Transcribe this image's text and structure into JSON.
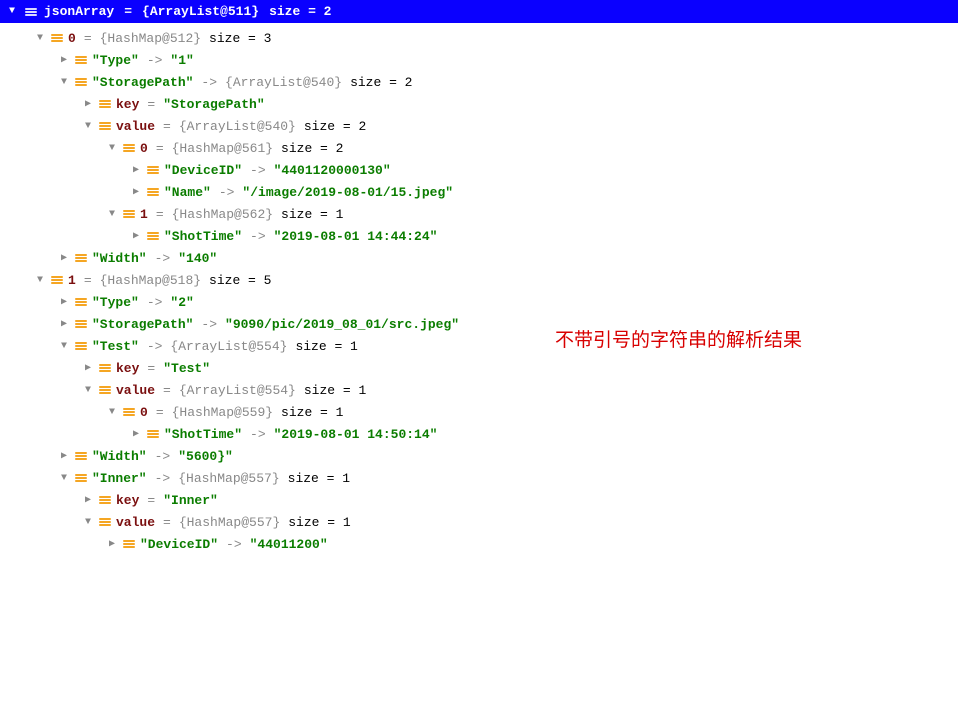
{
  "root": {
    "name": "jsonArray",
    "obj": "{ArrayList@511}",
    "size_label": "size = 2"
  },
  "annotation": "不带引号的字符串的解析结果",
  "r": {
    "i0": "0",
    "hm512": "{HashMap@512}",
    "sz3": "size = 3",
    "type_k": "\"Type\"",
    "type_v1": "\"1\"",
    "sp_k": "\"StoragePath\"",
    "al540": "{ArrayList@540}",
    "sz2": "size = 2",
    "key_label": "key",
    "sp_str": "\"StoragePath\"",
    "value_label": "value",
    "hm561": "{HashMap@561}",
    "devid_k": "\"DeviceID\"",
    "devid_v": "\"4401120000130\"",
    "name_k": "\"Name\"",
    "name_v": "\"/image/2019-08-01/15.jpeg\"",
    "i1": "1",
    "hm562": "{HashMap@562}",
    "sz1": "size = 1",
    "shot_k": "\"ShotTime\"",
    "shot_v1": "\"2019-08-01 14:44:24\"",
    "width_k": "\"Width\"",
    "width_v1": "\"140\"",
    "hm518": "{HashMap@518}",
    "sz5": "size = 5",
    "type_v2": "\"2\"",
    "sp_v2": "\"9090/pic/2019_08_01/src.jpeg\"",
    "test_k": "\"Test\"",
    "al554": "{ArrayList@554}",
    "test_str": "\"Test\"",
    "hm559": "{HashMap@559}",
    "shot_v2": "\"2019-08-01 14:50:14\"",
    "width_v2": "\"5600}\"",
    "inner_k": "\"Inner\"",
    "hm557": "{HashMap@557}",
    "inner_str": "\"Inner\"",
    "devid_v2": "\"44011200\""
  }
}
